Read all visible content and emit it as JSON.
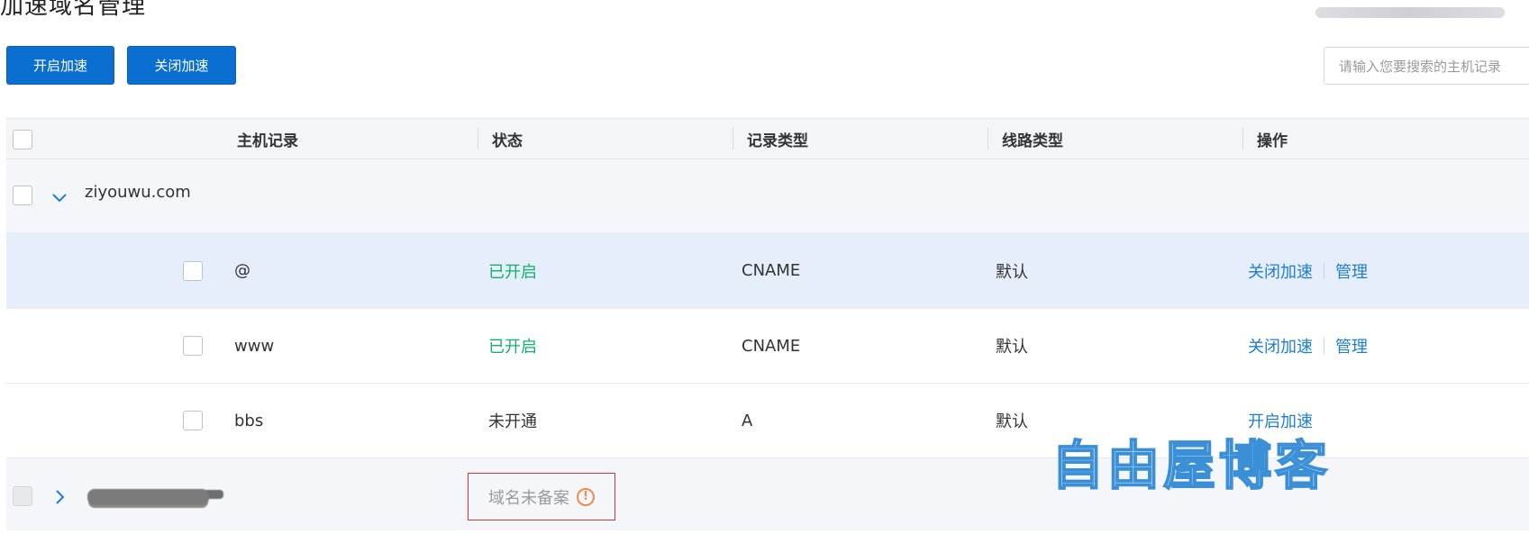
{
  "page": {
    "title": "加速域名管理"
  },
  "toolbar": {
    "open_label": "开启加速",
    "close_label": "关闭加速",
    "search_placeholder": "请输入您要搜索的主机记录"
  },
  "table": {
    "columns": [
      "主机记录",
      "状态",
      "记录类型",
      "线路类型",
      "操作"
    ],
    "group": {
      "domain": "ziyouwu.com"
    },
    "rows": [
      {
        "host": "@",
        "status": "已开启",
        "type": "CNAME",
        "line": "默认",
        "action1": "关闭加速",
        "action2": "管理"
      },
      {
        "host": "www",
        "status": "已开启",
        "type": "CNAME",
        "line": "默认",
        "action1": "关闭加速",
        "action2": "管理"
      },
      {
        "host": "bbs",
        "status": "未开通",
        "type": "A",
        "line": "默认",
        "action1": "开启加速"
      }
    ],
    "group2": {
      "status": "域名未备案"
    }
  },
  "watermark": {
    "text": "自由屋博客"
  },
  "colors": {
    "accent": "#0a6fd1",
    "link": "#1d7ed6",
    "status_on": "#10b26a",
    "warning": "#f08a4b",
    "highlight_row": "#e6eefb"
  },
  "icons": {
    "expanded": "chevron-down-icon",
    "collapsed": "chevron-right-icon",
    "warning": "warning-icon"
  }
}
